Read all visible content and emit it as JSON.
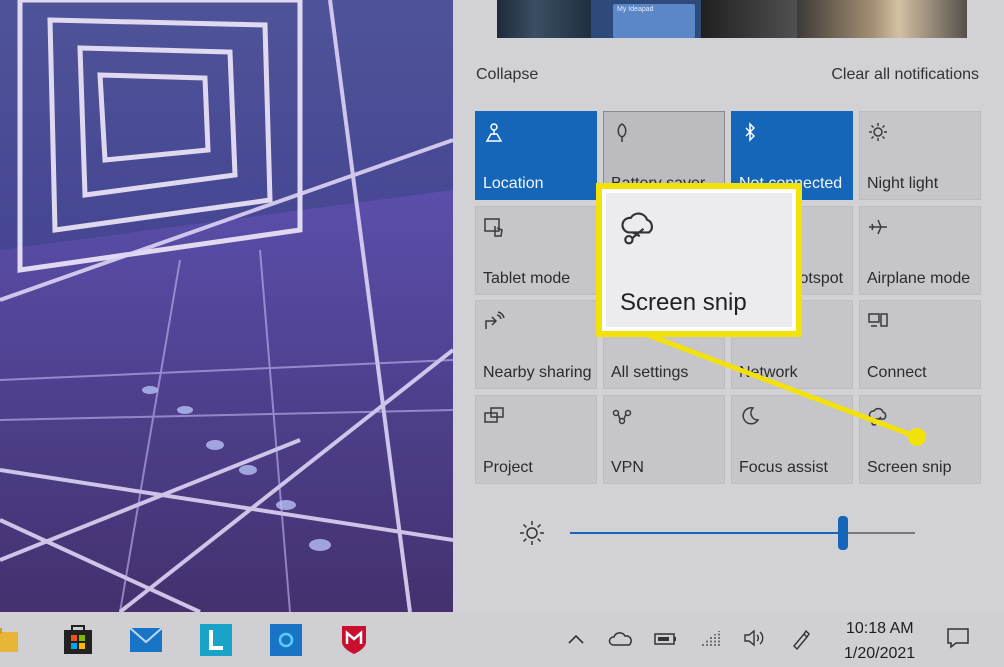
{
  "action_center": {
    "collapse_label": "Collapse",
    "clear_label": "Clear all notifications",
    "thumb_card_text": "My Ideapad",
    "tiles": [
      {
        "label": "Location",
        "icon": "location-icon",
        "state": "on"
      },
      {
        "label": "Battery saver",
        "icon": "battery-saver-icon",
        "state": "selected"
      },
      {
        "label": "Not connected",
        "icon": "bluetooth-icon",
        "state": "on"
      },
      {
        "label": "Night light",
        "icon": "night-light-icon",
        "state": "off"
      },
      {
        "label": "Tablet mode",
        "icon": "tablet-mode-icon",
        "state": "off"
      },
      {
        "label": "",
        "icon": "",
        "state": "off"
      },
      {
        "label": "Mobile hotspot",
        "icon": "mobile-hotspot-icon",
        "state": "off"
      },
      {
        "label": "Airplane mode",
        "icon": "airplane-icon",
        "state": "off"
      },
      {
        "label": "Nearby sharing",
        "icon": "nearby-sharing-icon",
        "state": "off"
      },
      {
        "label": "All settings",
        "icon": "settings-icon",
        "state": "off"
      },
      {
        "label": "Network",
        "icon": "network-icon",
        "state": "off"
      },
      {
        "label": "Connect",
        "icon": "connect-icon",
        "state": "off"
      },
      {
        "label": "Project",
        "icon": "project-icon",
        "state": "off"
      },
      {
        "label": "VPN",
        "icon": "vpn-icon",
        "state": "off"
      },
      {
        "label": "Focus assist",
        "icon": "moon-icon",
        "state": "off"
      },
      {
        "label": "Screen snip",
        "icon": "screen-snip-icon",
        "state": "off"
      }
    ],
    "brightness": {
      "icon": "sun-icon",
      "level_percent": 79
    }
  },
  "callout": {
    "label": "Screen snip",
    "icon": "screen-snip-icon",
    "color": "#f2e20a"
  },
  "taskbar": {
    "apps": [
      {
        "name": "file-explorer-icon"
      },
      {
        "name": "microsoft-store-icon"
      },
      {
        "name": "mail-icon"
      },
      {
        "name": "lenovo-vantage-icon",
        "text": "L"
      },
      {
        "name": "cortana-icon"
      },
      {
        "name": "mcafee-icon"
      }
    ],
    "tray": [
      "chevron-up-icon",
      "onedrive-icon",
      "battery-icon",
      "wifi-icon",
      "volume-icon",
      "pen-icon"
    ],
    "time": "10:18 AM",
    "date": "1/20/2021"
  },
  "colors": {
    "accent": "#1565b8",
    "tile": "#c6c6ca",
    "panel": "#d2d2d6",
    "taskbar": "#cfcfd4",
    "callout_border": "#f2e20a"
  }
}
